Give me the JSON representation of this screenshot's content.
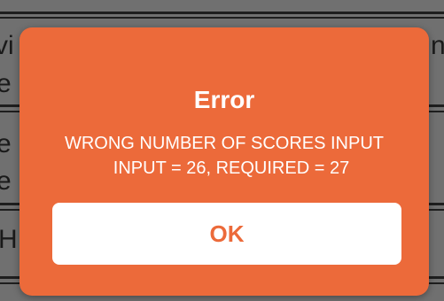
{
  "dialog": {
    "title": "Error",
    "message_line1": "WRONG NUMBER OF SCORES INPUT",
    "message_line2": "INPUT = 26, REQUIRED = 27",
    "ok_label": "OK",
    "background_color": "#ec6a3a",
    "button_color": "#ffffff"
  },
  "background": {
    "fragments": [
      "vi",
      "n",
      "e",
      "e",
      "e",
      "H"
    ]
  }
}
